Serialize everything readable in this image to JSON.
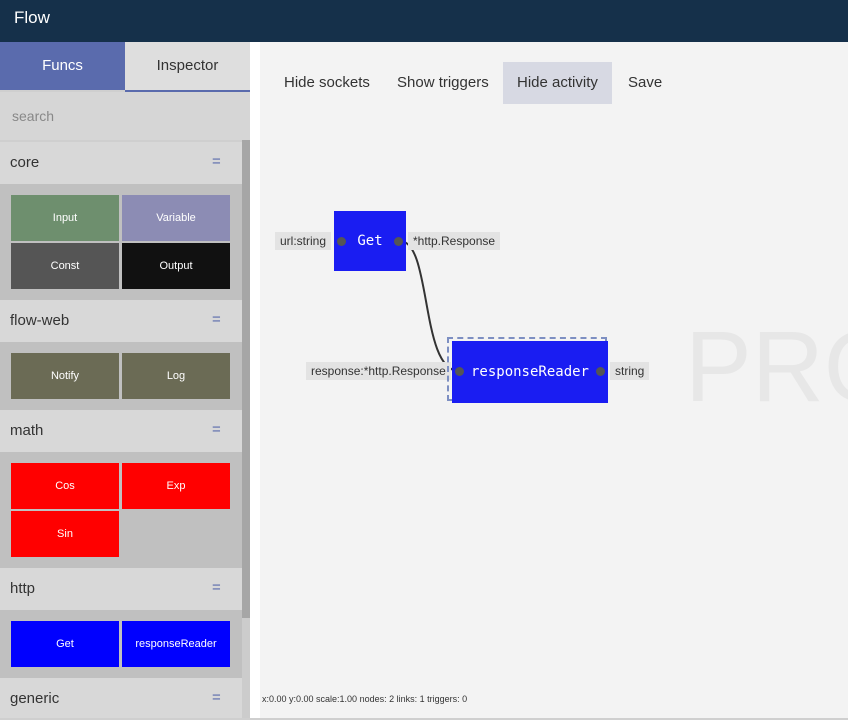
{
  "app": {
    "title": "Flow"
  },
  "sidebar": {
    "tabs": [
      {
        "label": "Funcs"
      },
      {
        "label": "Inspector"
      }
    ],
    "search_placeholder": "search",
    "categories": [
      {
        "name": "core",
        "menu_icon": "=",
        "items": [
          {
            "label": "Input",
            "color": "#6e8f6e"
          },
          {
            "label": "Variable",
            "color": "#8c8cb4"
          },
          {
            "label": "Const",
            "color": "#555555"
          },
          {
            "label": "Output",
            "color": "#111111"
          }
        ]
      },
      {
        "name": "flow-web",
        "menu_icon": "=",
        "items": [
          {
            "label": "Notify",
            "color": "#6b6b55"
          },
          {
            "label": "Log",
            "color": "#6b6b55"
          }
        ]
      },
      {
        "name": "math",
        "menu_icon": "=",
        "items": [
          {
            "label": "Cos",
            "color": "#ff0000"
          },
          {
            "label": "Exp",
            "color": "#ff0000"
          },
          {
            "label": "Sin",
            "color": "#ff0000"
          }
        ]
      },
      {
        "name": "http",
        "menu_icon": "=",
        "items": [
          {
            "label": "Get",
            "color": "#0000ff"
          },
          {
            "label": "responseReader",
            "color": "#0000ff"
          }
        ]
      },
      {
        "name": "generic",
        "menu_icon": "="
      }
    ]
  },
  "toolbar": {
    "hide_sockets": "Hide sockets",
    "show_triggers": "Show triggers",
    "hide_activity": "Hide activity",
    "save": "Save"
  },
  "canvas": {
    "watermark": "PRO",
    "nodes": [
      {
        "label": "Get",
        "input": "url:string",
        "output": "*http.Response"
      },
      {
        "label": "responseReader",
        "input": "response:*http.Response",
        "output": "string"
      }
    ],
    "status": "x:0.00 y:0.00 scale:1.00 nodes: 2 links: 1 triggers: 0"
  },
  "colors": {
    "appbar": "#15304a",
    "accent": "#5a6bad",
    "node": "#1a1df2"
  }
}
